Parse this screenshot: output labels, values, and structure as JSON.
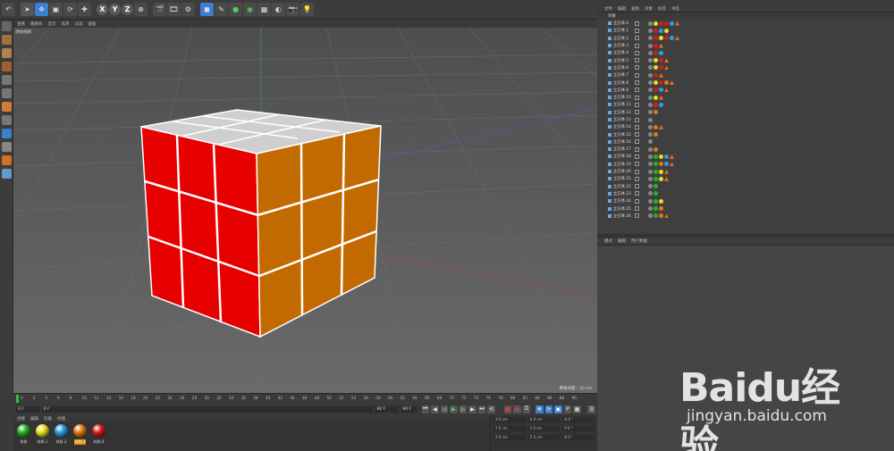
{
  "viewport": {
    "menu": [
      "查看",
      "摄像机",
      "显示",
      "选项",
      "过滤",
      "面板"
    ],
    "label": "透视视图",
    "scale": "网格间距 : 10 cm"
  },
  "timeline": {
    "ticks": [
      "0",
      "2",
      "4",
      "6",
      "8",
      "10",
      "12",
      "14",
      "16",
      "18",
      "20",
      "22",
      "24",
      "26",
      "28",
      "30",
      "32",
      "34",
      "36",
      "38",
      "40",
      "42",
      "44",
      "46",
      "48",
      "50",
      "52",
      "54",
      "56",
      "58",
      "60",
      "62",
      "64",
      "66",
      "68",
      "70",
      "72",
      "74",
      "76",
      "78",
      "80",
      "82",
      "84",
      "86",
      "88",
      "90"
    ],
    "start": "0 F",
    "current": "0 F",
    "end": "90 F",
    "end_right": "90 F"
  },
  "materials": {
    "menu": [
      "创建",
      "编辑",
      "功能",
      "纹理"
    ],
    "items": [
      {
        "label": "材质",
        "color": "#22b522",
        "selected": false
      },
      {
        "label": "材质.1",
        "color": "#e5e01a",
        "selected": false
      },
      {
        "label": "材质.2",
        "color": "#2a9fe0",
        "selected": false
      },
      {
        "label": "材质.3",
        "color": "#e07a10",
        "selected": true
      },
      {
        "label": "材质.4",
        "color": "#d81a1a",
        "selected": false
      }
    ]
  },
  "coords": {
    "rows": [
      [
        "X  0 cm",
        "X  0 cm",
        "H  0 °"
      ],
      [
        "Y  0 cm",
        "Y  0 cm",
        "P  0 °"
      ],
      [
        "Z  0 cm",
        "Z  0 cm",
        "B  0 °"
      ]
    ]
  },
  "objects": {
    "menu": [
      "文件",
      "编辑",
      "查看",
      "对象",
      "标签",
      "书签"
    ],
    "header": "对象",
    "items": [
      {
        "name": "立方体.0",
        "tags": [
          "#e5e01a",
          "#d81a1a",
          "#d81a1a",
          "#2a9fe0",
          "tri"
        ]
      },
      {
        "name": "立方体.1",
        "tags": [
          "#d81a1a",
          "#2a9fe0",
          "#e5e01a"
        ]
      },
      {
        "name": "立方体.2",
        "tags": [
          "#d81a1a",
          "#e5e01a",
          "#d81a1a",
          "#2a9fe0",
          "tri"
        ]
      },
      {
        "name": "立方体.3",
        "tags": [
          "#d81a1a",
          "tri"
        ]
      },
      {
        "name": "立方体.4",
        "tags": [
          "#d81a1a",
          "#2a9fe0"
        ]
      },
      {
        "name": "立方体.5",
        "tags": [
          "#e5e01a",
          "#d81a1a",
          "tri"
        ]
      },
      {
        "name": "立方体.6",
        "tags": [
          "#e5e01a",
          "#d81a1a",
          "tri"
        ]
      },
      {
        "name": "立方体.7",
        "tags": [
          "#d81a1a",
          "tri"
        ]
      },
      {
        "name": "立方体.8",
        "tags": [
          "#e5e01a",
          "#d81a1a",
          "#e07a10",
          "tri"
        ]
      },
      {
        "name": "立方体.9",
        "tags": [
          "#d81a1a",
          "#2a9fe0",
          "tri"
        ]
      },
      {
        "name": "立方体.10",
        "tags": [
          "#e5e01a",
          "tri"
        ]
      },
      {
        "name": "立方体.11",
        "tags": [
          "#d81a1a",
          "#2a9fe0"
        ]
      },
      {
        "name": "立方体.12",
        "tags": [
          "#e07a10"
        ]
      },
      {
        "name": "立方体.13",
        "tags": []
      },
      {
        "name": "立方体.14",
        "tags": [
          "#e07a10",
          "tri"
        ]
      },
      {
        "name": "立方体.15",
        "tags": [
          "#e07a10"
        ]
      },
      {
        "name": "立方体.16",
        "tags": []
      },
      {
        "name": "立方体.17",
        "tags": [
          "#e07a10"
        ]
      },
      {
        "name": "立方体.18",
        "tags": [
          "#22b522",
          "#e5e01a",
          "#2a9fe0",
          "tri"
        ]
      },
      {
        "name": "立方体.19",
        "tags": [
          "#22b522",
          "#e07a10",
          "#2a9fe0",
          "tri"
        ]
      },
      {
        "name": "立方体.20",
        "tags": [
          "#22b522",
          "#e5e01a",
          "tri"
        ]
      },
      {
        "name": "立方体.21",
        "tags": [
          "#22b522",
          "#e5e01a",
          "tri"
        ]
      },
      {
        "name": "立方体.22",
        "tags": [
          "#22b522"
        ]
      },
      {
        "name": "立方体.23",
        "tags": [
          "#22b522"
        ]
      },
      {
        "name": "立方体.24",
        "tags": [
          "#22b522",
          "#e5e01a"
        ]
      },
      {
        "name": "立方体.25",
        "tags": [
          "#22b522",
          "#e07a10"
        ]
      },
      {
        "name": "立方体.26",
        "tags": [
          "#22b522",
          "#e07a10",
          "tri"
        ]
      }
    ]
  },
  "attributes": {
    "menu": [
      "模式",
      "编辑",
      "用户数据"
    ]
  },
  "watermark": {
    "text": "Baidu经验",
    "url": "jingyan.baidu.com"
  }
}
